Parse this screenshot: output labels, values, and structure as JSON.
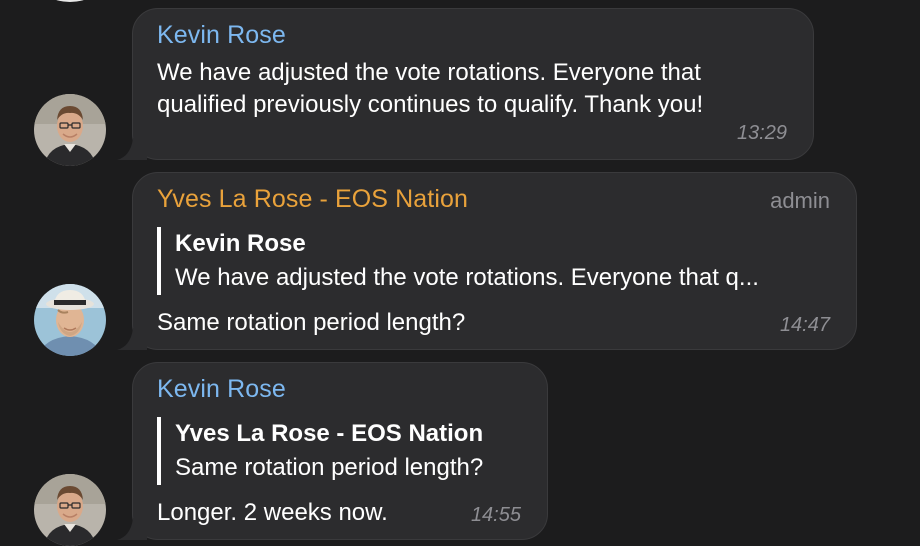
{
  "messages": [
    {
      "sender": "Kevin Rose",
      "text_lines": [
        "We have adjusted the vote rotations. Everyone that",
        "qualified previously continues to qualify. Thank you!"
      ],
      "time": "13:29"
    },
    {
      "sender": "Yves La Rose - EOS Nation",
      "role": "admin",
      "reply_to": {
        "sender": "Kevin Rose",
        "text": "We have adjusted the vote rotations. Everyone that q..."
      },
      "text": "Same rotation period length?",
      "time": "14:47"
    },
    {
      "sender": "Kevin Rose",
      "reply_to": {
        "sender": "Yves La Rose - EOS Nation",
        "text": "Same rotation period length?"
      },
      "text": "Longer. 2 weeks now.",
      "time": "14:55"
    }
  ],
  "colors": {
    "background": "#1c1c1d",
    "bubble": "#2c2c2e",
    "sender_kevin": "#7db8f0",
    "sender_yves": "#e9a23b",
    "meta": "#8e8e93"
  }
}
